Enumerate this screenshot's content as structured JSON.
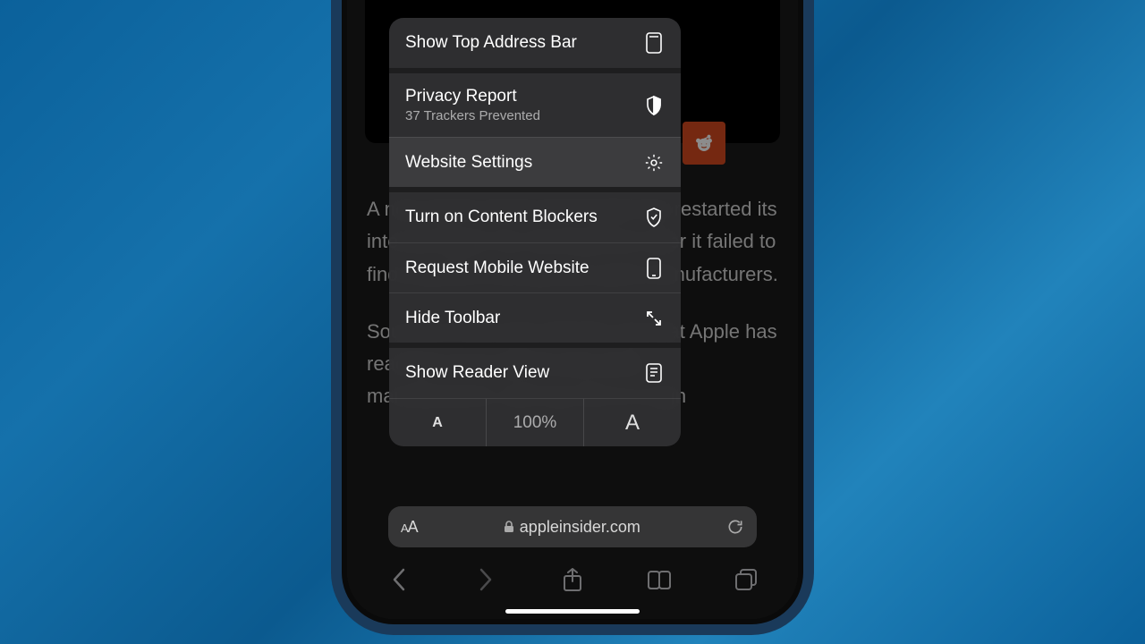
{
  "menu": {
    "show_top_address_bar": "Show Top Address Bar",
    "privacy_report": {
      "label": "Privacy Report",
      "sub": "37 Trackers Prevented"
    },
    "website_settings": "Website Settings",
    "content_blockers": "Turn on Content Blockers",
    "request_mobile": "Request Mobile Website",
    "hide_toolbar": "Hide Toolbar",
    "show_reader": "Show Reader View",
    "font": {
      "decrease": "A",
      "percent": "100%",
      "increase": "A"
    }
  },
  "article": {
    "paragraph1": "A new report claims that Apple has restarted its internal Apple Car development after it failed to find a partner among auto parts manufacturers.",
    "paragraph2": "Sources in the auto industry say that Apple has reached out to global auto parts manufacturers, and say this is a sign"
  },
  "address_bar": {
    "domain": "appleinsider.com"
  }
}
